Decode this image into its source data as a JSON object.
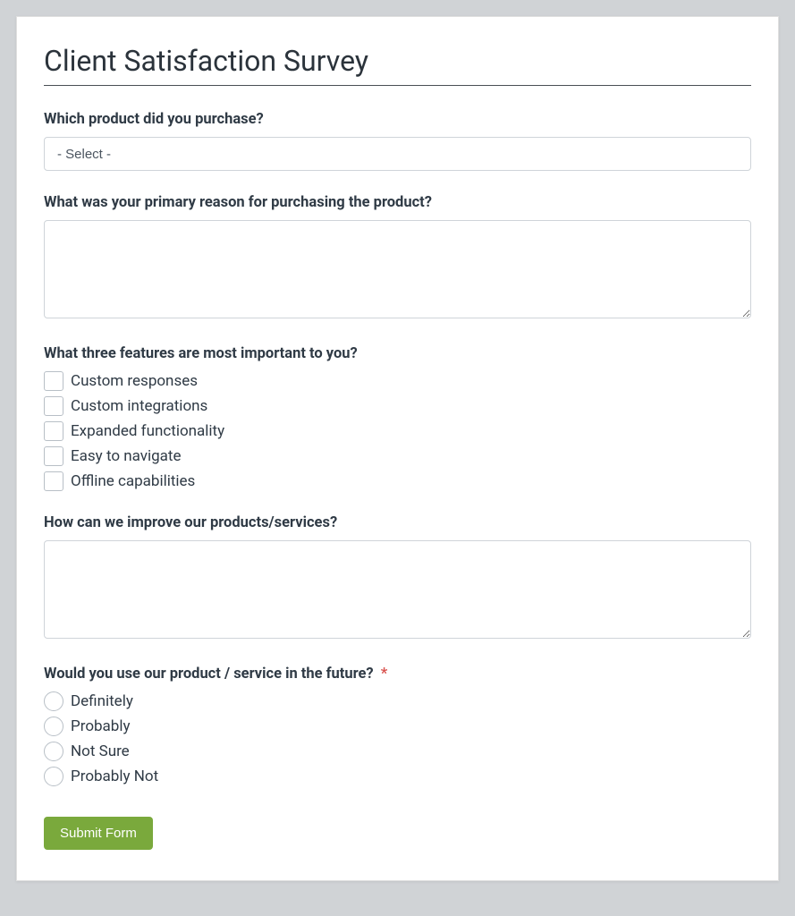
{
  "title": "Client Satisfaction Survey",
  "questions": {
    "q1": {
      "label": "Which product did you purchase?",
      "placeholder": "- Select -"
    },
    "q2": {
      "label": "What was your primary reason for purchasing the product?"
    },
    "q3": {
      "label": "What three features are most important to you?",
      "options": [
        "Custom responses",
        "Custom integrations",
        "Expanded functionality",
        "Easy to navigate",
        "Offline capabilities"
      ]
    },
    "q4": {
      "label": "How can we improve our products/services?"
    },
    "q5": {
      "label": "Would you use our product / service in the future?",
      "required_mark": "*",
      "options": [
        "Definitely",
        "Probably",
        "Not Sure",
        "Probably Not"
      ]
    }
  },
  "submit_label": "Submit Form"
}
